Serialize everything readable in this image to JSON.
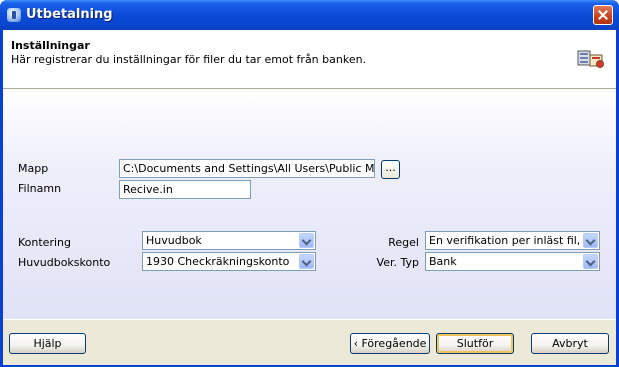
{
  "window": {
    "title": "Utbetalning"
  },
  "header": {
    "title": "Inställningar",
    "subtitle": "Här registrerar du inställningar för filer du tar emot från banken."
  },
  "form": {
    "mapp_label": "Mapp",
    "mapp_value": "C:\\Documents and Settings\\All Users\\Public Mamut\\",
    "browse_label": "...",
    "filnamn_label": "Filnamn",
    "filnamn_value": "Recive.in",
    "kontering_label": "Kontering",
    "kontering_value": "Huvudbok",
    "huvudbokskonto_label": "Huvudbokskonto",
    "huvudbokskonto_value": "1930 Checkräkningskonto",
    "regel_label": "Regel",
    "regel_value": "En verifikation per inläst fil, en ba",
    "vertyp_label": "Ver. Typ",
    "vertyp_value": "Bank"
  },
  "footer": {
    "help_label": "Hjälp",
    "back_label": "Föregående",
    "finish_label": "Slutför",
    "cancel_label": "Avbryt"
  },
  "colors": {
    "titlebar": "#0b4ad8",
    "dialog_bg": "#ece9d8",
    "border": "#7f9db9"
  }
}
